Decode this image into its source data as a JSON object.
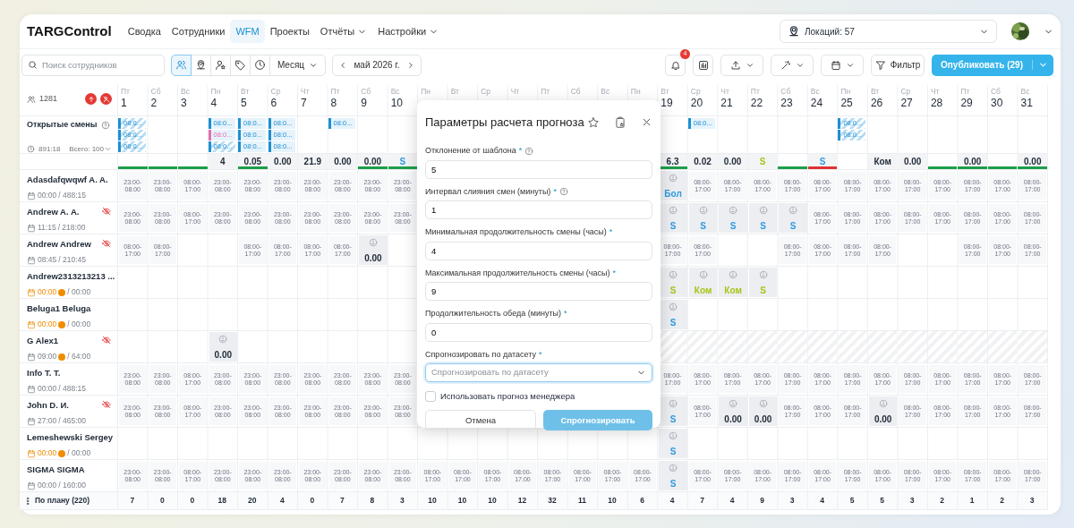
{
  "navbar": {
    "brand": "TARGControl",
    "items": [
      {
        "label": "Сводка",
        "selected": false,
        "dropdown": false
      },
      {
        "label": "Сотрудники",
        "selected": false,
        "dropdown": false
      },
      {
        "label": "WFM",
        "selected": true,
        "dropdown": false
      },
      {
        "label": "Проекты",
        "selected": false,
        "dropdown": false
      },
      {
        "label": "Отчёты",
        "selected": false,
        "dropdown": true
      },
      {
        "label": "Настройки",
        "selected": false,
        "dropdown": true
      }
    ],
    "location": {
      "label": "Локаций: 57"
    }
  },
  "toolbar": {
    "search": {
      "placeholder": "Поиск сотрудников"
    },
    "view_buttons": [
      {
        "kind": "people",
        "selected": true
      },
      {
        "kind": "pin",
        "selected": false
      },
      {
        "kind": "userstar",
        "selected": false
      },
      {
        "kind": "tag",
        "selected": false
      },
      {
        "kind": "clock",
        "selected": false
      }
    ],
    "period": {
      "label": "Месяц"
    },
    "date": {
      "label": "май 2026 г."
    },
    "notifications": {
      "count": "4"
    },
    "filter": {
      "label": "Фильтр"
    },
    "publish": {
      "label": "Опубликовать (29)"
    }
  },
  "grid": {
    "employee_count": "1281",
    "open_shifts": {
      "title": "Открытые смены",
      "hours": "891:18",
      "total": "Всего: 100"
    },
    "days": [
      {
        "weekday": "Пт",
        "number": "1",
        "open_shifts": [
          {
            "text": "08:0...",
            "color": "#1d8fd1",
            "hatched": true
          },
          {
            "text": "08:0...",
            "color": "#1d8fd1",
            "hatched": true
          },
          {
            "text": "08:0...",
            "color": "#1d8fd1",
            "hatched": true
          }
        ],
        "summary": {
          "bar": {
            "color": "#1e9e4a"
          }
        },
        "total": "7"
      },
      {
        "weekday": "Сб",
        "number": "2",
        "summary": {
          "bar": {
            "color": "#1e9e4a"
          }
        },
        "total": "0"
      },
      {
        "weekday": "Вс",
        "number": "3",
        "summary": {
          "bar": {
            "color": "#1e9e4a"
          }
        },
        "total": "0"
      },
      {
        "weekday": "Пн",
        "number": "4",
        "open_shifts": [
          {
            "text": "08:0...",
            "color": "#1d8fd1",
            "hatched": false
          },
          {
            "text": "08:0...",
            "color": "#e46fb0",
            "hatched": false
          },
          {
            "text": "08:0...",
            "color": "#1d8fd1",
            "hatched": true
          }
        ],
        "summary": {
          "text": "4",
          "color": "#1f2937"
        },
        "total": "18"
      },
      {
        "weekday": "Вт",
        "number": "5",
        "open_shifts": [
          {
            "text": "08:0...",
            "color": "#1d8fd1",
            "hatched": false
          },
          {
            "text": "08:0...",
            "color": "#1d8fd1",
            "hatched": false
          },
          {
            "text": "08:0...",
            "color": "#1d8fd1",
            "hatched": false
          }
        ],
        "summary": {
          "text": "0.05",
          "color": "#1f2937",
          "bar": {
            "color": "#1e9e4a"
          }
        },
        "total": "20"
      },
      {
        "weekday": "Ср",
        "number": "6",
        "open_shifts": [
          {
            "text": "08:0...",
            "color": "#1d8fd1",
            "hatched": false
          },
          {
            "text": "08:0...",
            "color": "#1d8fd1",
            "hatched": false
          },
          {
            "text": "08:0...",
            "color": "#1d8fd1",
            "hatched": false
          }
        ],
        "summary": {
          "text": "0.00",
          "color": "#1f2937"
        },
        "total": "4"
      },
      {
        "weekday": "Чт",
        "number": "7",
        "summary": {
          "text": "21.9",
          "color": "#1f2937"
        },
        "total": "0"
      },
      {
        "weekday": "Пт",
        "number": "8",
        "open_shifts": [
          {
            "text": "08:0...",
            "color": "#1d8fd1",
            "hatched": false
          }
        ],
        "summary": {
          "text": "0.00",
          "color": "#1f2937"
        },
        "total": "7"
      },
      {
        "weekday": "Сб",
        "number": "9",
        "summary": {
          "text": "0.00",
          "color": "#1f2937",
          "bar": {
            "color": "#1e9e4a"
          }
        },
        "total": "8"
      },
      {
        "weekday": "Вс",
        "number": "10",
        "summary": {
          "text": "S",
          "color": "#2f9be0",
          "bar": {
            "color": "#1e9e4a"
          }
        },
        "total": "3"
      },
      {
        "weekday": "Пн",
        "total": "10"
      },
      {
        "weekday": "Вт",
        "total": "10"
      },
      {
        "weekday": "Ср",
        "total": "10"
      },
      {
        "weekday": "Чт",
        "total": "12"
      },
      {
        "weekday": "Пт",
        "total": "32"
      },
      {
        "weekday": "Сб",
        "total": "11"
      },
      {
        "weekday": "Вс",
        "total": "10"
      },
      {
        "weekday": "Пн",
        "total": "6"
      },
      {
        "weekday": "Вт",
        "number": "19",
        "summary": {
          "text": "6.3",
          "color": "#1f2937",
          "bar": {
            "color": "#1e9e4a"
          }
        },
        "total": "4"
      },
      {
        "weekday": "Ср",
        "number": "20",
        "open_shifts": [
          {
            "text": "08:0...",
            "color": "#1d8fd1",
            "hatched": false
          }
        ],
        "summary": {
          "text": "0.02",
          "color": "#1f2937"
        },
        "total": "7"
      },
      {
        "weekday": "Чт",
        "number": "21",
        "summary": {
          "text": "0.00",
          "color": "#1f2937"
        },
        "total": "4"
      },
      {
        "weekday": "Пт",
        "number": "22",
        "summary": {
          "text": "S",
          "color": "#a8c416"
        },
        "total": "9"
      },
      {
        "weekday": "Сб",
        "number": "23",
        "summary": {
          "bar": {
            "color": "#1e9e4a"
          }
        },
        "total": "3"
      },
      {
        "weekday": "Вс",
        "number": "24",
        "summary": {
          "text": "S",
          "color": "#2f9be0",
          "bar": {
            "color": "#e03131"
          }
        },
        "total": "4"
      },
      {
        "weekday": "Пн",
        "number": "25",
        "open_shifts": [
          {
            "text": "08:0...",
            "color": "#1d8fd1",
            "hatched": true
          },
          {
            "text": "08:0...",
            "color": "#1d8fd1",
            "hatched": true
          }
        ],
        "total": "5"
      },
      {
        "weekday": "Вт",
        "number": "26",
        "summary": {
          "text": "Ком",
          "color": "#1f2937"
        },
        "total": "5"
      },
      {
        "weekday": "Ср",
        "number": "27",
        "summary": {
          "text": "0.00",
          "color": "#1f2937"
        },
        "total": "3"
      },
      {
        "weekday": "Чт",
        "number": "28",
        "summary": {
          "bar": {
            "color": "#1e9e4a"
          }
        },
        "total": "2"
      },
      {
        "weekday": "Пт",
        "number": "29",
        "summary": {
          "text": "0.00",
          "color": "#1f2937",
          "bar": {
            "color": "#1e9e4a"
          }
        },
        "total": "1"
      },
      {
        "weekday": "Сб",
        "number": "30",
        "summary": {
          "bar": {
            "color": "#1e9e4a"
          }
        },
        "total": "2"
      },
      {
        "weekday": "Вс",
        "number": "31",
        "summary": {
          "text": "0.00",
          "color": "#1f2937",
          "bar": {
            "color": "#1e9e4a"
          }
        },
        "total": "3"
      }
    ],
    "rows": [
      {
        "name": "Adasdafqwqwf A. A.",
        "worked": "00:00",
        "norm": "/ 488:15",
        "alert": false,
        "dot": false,
        "hidden": false,
        "cells": [
          {
            "kind": "shift",
            "time": "23:00-08:00"
          },
          {
            "kind": "shift",
            "time": "23:00-08:00"
          },
          {
            "kind": "shift",
            "time": "08:00-17:00"
          },
          {
            "kind": "shift",
            "time": "23:00-08:00"
          },
          {
            "kind": "shift",
            "time": "23:00-08:00"
          },
          {
            "kind": "shift",
            "time": "23:00-08:00"
          },
          {
            "kind": "shift",
            "time": "23:00-08:00"
          },
          {
            "kind": "shift",
            "time": "23:00-08:00"
          },
          {
            "kind": "shift",
            "time": "23:00-08:00"
          },
          {
            "kind": "shift",
            "time": "23:00-08:00"
          },
          null,
          null,
          null,
          null,
          null,
          null,
          null,
          null,
          {
            "kind": "absence",
            "label": "Бол",
            "color": "#2f9be0"
          },
          {
            "kind": "shift",
            "time": "08:00-17:00"
          },
          {
            "kind": "shift",
            "time": "08:00-17:00"
          },
          {
            "kind": "shift",
            "time": "08:00-17:00"
          },
          {
            "kind": "shift",
            "time": "08:00-17:00"
          },
          {
            "kind": "shift",
            "time": "08:00-17:00"
          },
          {
            "kind": "shift",
            "time": "08:00-17:00"
          },
          {
            "kind": "shift",
            "time": "08:00-17:00"
          },
          {
            "kind": "shift",
            "time": "08:00-17:00"
          },
          {
            "kind": "shift",
            "time": "08:00-17:00"
          },
          {
            "kind": "shift",
            "time": "08:00-17:00"
          },
          {
            "kind": "shift",
            "time": "08:00-17:00"
          },
          {
            "kind": "shift",
            "time": "08:00-17:00"
          }
        ]
      },
      {
        "name": "Andrew A. A.",
        "worked": "11:15",
        "norm": "/ 218:00",
        "alert": false,
        "dot": false,
        "hidden": true,
        "cells": [
          {
            "kind": "shift",
            "time": "23:00-08:00"
          },
          {
            "kind": "shift",
            "time": "23:00-08:00"
          },
          {
            "kind": "shift",
            "time": "08:00-17:00"
          },
          {
            "kind": "shift",
            "time": "23:00-08:00"
          },
          {
            "kind": "shift",
            "time": "23:00-08:00"
          },
          {
            "kind": "shift",
            "time": "23:00-08:00"
          },
          {
            "kind": "shift",
            "time": "23:00-08:00"
          },
          {
            "kind": "shift",
            "time": "23:00-08:00"
          },
          {
            "kind": "shift",
            "time": "23:00-08:00"
          },
          {
            "kind": "shift",
            "time": "23:00-08:00"
          },
          null,
          null,
          null,
          null,
          null,
          null,
          null,
          null,
          {
            "kind": "absence",
            "label": "S",
            "color": "#2f9be0"
          },
          {
            "kind": "absence",
            "label": "S",
            "color": "#2f9be0"
          },
          {
            "kind": "absence",
            "label": "S",
            "color": "#2f9be0"
          },
          {
            "kind": "absence",
            "label": "S",
            "color": "#2f9be0"
          },
          {
            "kind": "absence",
            "label": "S",
            "color": "#2f9be0"
          },
          {
            "kind": "shift",
            "time": "08:00-17:00"
          },
          {
            "kind": "shift",
            "time": "08:00-17:00"
          },
          {
            "kind": "shift",
            "time": "08:00-17:00"
          },
          {
            "kind": "shift",
            "time": "08:00-17:00"
          },
          {
            "kind": "shift",
            "time": "08:00-17:00"
          },
          {
            "kind": "shift",
            "time": "08:00-17:00"
          },
          {
            "kind": "shift",
            "time": "08:00-17:00"
          },
          {
            "kind": "shift",
            "time": "08:00-17:00"
          }
        ]
      },
      {
        "name": "Andrew Andrew",
        "worked": "08:45",
        "norm": "/ 210:45",
        "alert": false,
        "dot": false,
        "hidden": true,
        "cells": [
          {
            "kind": "shift",
            "time": "08:00-17:00"
          },
          {
            "kind": "shift",
            "time": "08:00-17:00"
          },
          null,
          null,
          {
            "kind": "shift",
            "time": "08:00-17:00"
          },
          {
            "kind": "shift",
            "time": "08:00-17:00"
          },
          {
            "kind": "shift",
            "time": "08:00-17:00"
          },
          {
            "kind": "shift",
            "time": "08:00-17:00"
          },
          {
            "kind": "absence",
            "label": "0.00",
            "color": "#1f2937"
          },
          null,
          null,
          null,
          null,
          null,
          null,
          null,
          null,
          null,
          {
            "kind": "shift",
            "time": "08:00-17:00"
          },
          {
            "kind": "shift",
            "time": "08:00-17:00"
          },
          null,
          null,
          {
            "kind": "shift",
            "time": "08:00-17:00"
          },
          {
            "kind": "shift",
            "time": "08:00-17:00"
          },
          {
            "kind": "shift",
            "time": "08:00-17:00"
          },
          {
            "kind": "shift",
            "time": "08:00-17:00"
          },
          null,
          null,
          {
            "kind": "shift",
            "time": "08:00-17:00"
          },
          {
            "kind": "shift",
            "time": "08:00-17:00"
          },
          {
            "kind": "shift",
            "time": "08:00-17:00"
          }
        ]
      },
      {
        "name": "Andrew2313213213 ...",
        "worked": "00:00",
        "norm": "/ 00:00",
        "alert": true,
        "dot": true,
        "hidden": false,
        "cells": [
          null,
          null,
          null,
          null,
          null,
          null,
          null,
          null,
          null,
          null,
          null,
          null,
          null,
          null,
          null,
          null,
          null,
          null,
          {
            "kind": "absence",
            "label": "S",
            "color": "#a8c416"
          },
          {
            "kind": "absence",
            "label": "Ком",
            "color": "#a8c416"
          },
          {
            "kind": "absence",
            "label": "Ком",
            "color": "#a8c416"
          },
          {
            "kind": "absence",
            "label": "S",
            "color": "#a8c416"
          },
          null,
          null,
          null,
          null,
          null,
          null,
          null,
          null,
          null
        ]
      },
      {
        "name": "Beluga1 Beluga",
        "worked": "00:00",
        "norm": "/ 00:00",
        "alert": true,
        "dot": true,
        "hidden": false,
        "cells": [
          null,
          null,
          null,
          null,
          null,
          null,
          null,
          null,
          null,
          null,
          null,
          null,
          null,
          null,
          null,
          null,
          null,
          null,
          {
            "kind": "absence",
            "label": "S",
            "color": "#2f9be0"
          },
          null,
          null,
          null,
          null,
          null,
          null,
          null,
          null,
          null,
          null,
          null,
          null
        ]
      },
      {
        "name": "G Alex1",
        "worked": "09:00",
        "norm": "/ 64:00",
        "alert": false,
        "dot": true,
        "hidden": true,
        "cells": [
          null,
          null,
          null,
          {
            "kind": "absence",
            "label": "0.00",
            "color": "#1f2937"
          },
          null,
          null,
          null,
          null,
          null,
          null,
          null,
          null,
          null,
          null,
          null,
          null,
          null,
          null,
          {
            "kind": "blocked"
          },
          {
            "kind": "blocked"
          },
          {
            "kind": "blocked"
          },
          {
            "kind": "blocked"
          },
          {
            "kind": "blocked"
          },
          {
            "kind": "blocked"
          },
          {
            "kind": "blocked"
          },
          {
            "kind": "blocked"
          },
          {
            "kind": "blocked"
          },
          {
            "kind": "blocked"
          },
          {
            "kind": "blocked"
          },
          {
            "kind": "blocked"
          },
          {
            "kind": "blocked"
          }
        ]
      },
      {
        "name": "Info T. T.",
        "worked": "00:00",
        "norm": "/ 488:15",
        "alert": false,
        "dot": false,
        "hidden": false,
        "cells": [
          {
            "kind": "shift",
            "time": "23:00-08:00"
          },
          {
            "kind": "shift",
            "time": "23:00-08:00"
          },
          {
            "kind": "shift",
            "time": "08:00-17:00"
          },
          {
            "kind": "shift",
            "time": "23:00-08:00"
          },
          {
            "kind": "shift",
            "time": "23:00-08:00"
          },
          {
            "kind": "shift",
            "time": "23:00-08:00"
          },
          {
            "kind": "shift",
            "time": "23:00-08:00"
          },
          {
            "kind": "shift",
            "time": "23:00-08:00"
          },
          {
            "kind": "shift",
            "time": "23:00-08:00"
          },
          {
            "kind": "shift",
            "time": "23:00-08:00"
          },
          null,
          null,
          null,
          null,
          null,
          null,
          null,
          null,
          {
            "kind": "shift",
            "time": "08:00-17:00"
          },
          {
            "kind": "shift",
            "time": "08:00-17:00"
          },
          {
            "kind": "shift",
            "time": "08:00-17:00"
          },
          {
            "kind": "shift",
            "time": "08:00-17:00"
          },
          {
            "kind": "shift",
            "time": "08:00-17:00"
          },
          {
            "kind": "shift",
            "time": "08:00-17:00"
          },
          {
            "kind": "shift",
            "time": "08:00-17:00"
          },
          {
            "kind": "shift",
            "time": "08:00-17:00"
          },
          {
            "kind": "shift",
            "time": "08:00-17:00"
          },
          {
            "kind": "shift",
            "time": "08:00-17:00"
          },
          {
            "kind": "shift",
            "time": "08:00-17:00"
          },
          {
            "kind": "shift",
            "time": "08:00-17:00"
          },
          {
            "kind": "shift",
            "time": "08:00-17:00"
          }
        ]
      },
      {
        "name": "John D. И.",
        "worked": "27:00",
        "norm": "/ 465:00",
        "alert": false,
        "dot": false,
        "hidden": true,
        "cells": [
          {
            "kind": "shift",
            "time": "23:00-08:00"
          },
          {
            "kind": "shift",
            "time": "23:00-08:00"
          },
          {
            "kind": "shift",
            "time": "08:00-17:00"
          },
          {
            "kind": "shift",
            "time": "23:00-08:00"
          },
          {
            "kind": "shift",
            "time": "23:00-08:00"
          },
          {
            "kind": "shift",
            "time": "23:00-08:00"
          },
          {
            "kind": "shift",
            "time": "23:00-08:00"
          },
          {
            "kind": "shift",
            "time": "23:00-08:00"
          },
          {
            "kind": "shift",
            "time": "23:00-08:00"
          },
          {
            "kind": "shift",
            "time": "23:00-08:00"
          },
          null,
          null,
          null,
          null,
          null,
          null,
          null,
          null,
          {
            "kind": "absence",
            "label": "S",
            "color": "#2f9be0"
          },
          {
            "kind": "shift",
            "time": "08:00-17:00"
          },
          {
            "kind": "absence",
            "label": "0.00",
            "color": "#1f2937"
          },
          {
            "kind": "absence",
            "label": "0.00",
            "color": "#1f2937"
          },
          {
            "kind": "shift",
            "time": "08:00-17:00"
          },
          {
            "kind": "shift",
            "time": "08:00-17:00"
          },
          {
            "kind": "shift",
            "time": "08:00-17:00"
          },
          {
            "kind": "absence",
            "label": "0.00",
            "color": "#1f2937"
          },
          {
            "kind": "shift",
            "time": "08:00-17:00"
          },
          {
            "kind": "shift",
            "time": "08:00-17:00"
          },
          {
            "kind": "shift",
            "time": "08:00-17:00"
          },
          {
            "kind": "shift",
            "time": "08:00-17:00"
          },
          {
            "kind": "shift",
            "time": "08:00-17:00"
          }
        ]
      },
      {
        "name": "Lemeshewski Sergey",
        "worked": "00:00",
        "norm": "/ 00:00",
        "alert": true,
        "dot": true,
        "hidden": false,
        "cells": [
          null,
          null,
          null,
          null,
          null,
          null,
          null,
          null,
          null,
          null,
          null,
          null,
          null,
          null,
          null,
          null,
          null,
          null,
          {
            "kind": "absence",
            "label": "S",
            "color": "#2f9be0"
          },
          null,
          null,
          null,
          null,
          null,
          null,
          null,
          null,
          null,
          null,
          null,
          null
        ]
      },
      {
        "name": "SIGMA SIGMA",
        "worked": "00:00",
        "norm": "/ 160:00",
        "alert": false,
        "dot": false,
        "hidden": false,
        "cells": [
          {
            "kind": "shift",
            "time": "23:00-08:00"
          },
          {
            "kind": "shift",
            "time": "23:00-08:00"
          },
          {
            "kind": "shift",
            "time": "08:00-17:00"
          },
          {
            "kind": "shift",
            "time": "23:00-08:00"
          },
          {
            "kind": "shift",
            "time": "23:00-08:00"
          },
          {
            "kind": "shift",
            "time": "23:00-08:00"
          },
          {
            "kind": "shift",
            "time": "23:00-08:00"
          },
          {
            "kind": "shift",
            "time": "23:00-08:00"
          },
          {
            "kind": "shift",
            "time": "23:00-08:00"
          },
          {
            "kind": "shift",
            "time": "23:00-08:00"
          },
          {
            "kind": "shift",
            "time": "08:00-17:00"
          },
          {
            "kind": "shift",
            "time": "08:00-17:00"
          },
          {
            "kind": "shift",
            "time": "08:00-17:00"
          },
          {
            "kind": "shift",
            "time": "08:00-17:00"
          },
          {
            "kind": "shift",
            "time": "08:00-17:00"
          },
          {
            "kind": "shift",
            "time": "08:00-17:00"
          },
          {
            "kind": "shift",
            "time": "08:00-17:00"
          },
          {
            "kind": "shift",
            "time": "08:00-17:00"
          },
          {
            "kind": "absence",
            "label": "S",
            "color": "#2f9be0"
          },
          {
            "kind": "shift",
            "time": "08:00-17:00"
          },
          {
            "kind": "shift",
            "time": "08:00-17:00"
          },
          {
            "kind": "shift",
            "time": "08:00-17:00"
          },
          {
            "kind": "shift",
            "time": "08:00-17:00"
          },
          {
            "kind": "shift",
            "time": "08:00-17:00"
          },
          {
            "kind": "shift",
            "time": "08:00-17:00"
          },
          {
            "kind": "shift",
            "time": "08:00-17:00"
          },
          {
            "kind": "shift",
            "time": "08:00-17:00"
          },
          {
            "kind": "shift",
            "time": "08:00-17:00"
          },
          {
            "kind": "shift",
            "time": "08:00-17:00"
          },
          {
            "kind": "shift",
            "time": "08:00-17:00"
          },
          {
            "kind": "shift",
            "time": "08:00-17:00"
          }
        ]
      }
    ],
    "footer": {
      "label": "По плану (220)"
    }
  },
  "dialog": {
    "title": "Параметры расчета прогноза",
    "fields": [
      {
        "kind": "input",
        "label": "Отклонение от шаблона",
        "required": "*",
        "help": true,
        "value": "5"
      },
      {
        "kind": "input",
        "label": "Интервал слияния смен (минуты)",
        "required": "*",
        "help": true,
        "value": "1"
      },
      {
        "kind": "input",
        "label": "Минимальная продолжительность смены (часы)",
        "required": "*",
        "help": false,
        "value": "4"
      },
      {
        "kind": "input",
        "label": "Максимальная продолжительность смены (часы)",
        "required": "*",
        "help": false,
        "value": "9"
      },
      {
        "kind": "input",
        "label": "Продолжительность обеда (минуты)",
        "required": "*",
        "help": false,
        "value": "0"
      },
      {
        "kind": "select",
        "label": "Спрогнозировать по датасету",
        "required": "*",
        "help": false,
        "placeholder": "Спрогнозировать по датасету",
        "focused": true
      }
    ],
    "checkbox": {
      "label": "Использовать прогноз менеджера",
      "checked": false
    },
    "buttons": [
      {
        "label": "Отмена",
        "kind": "secondary",
        "disabled": false
      },
      {
        "label": "Спрогнозировать",
        "kind": "primary",
        "disabled": true
      }
    ]
  }
}
